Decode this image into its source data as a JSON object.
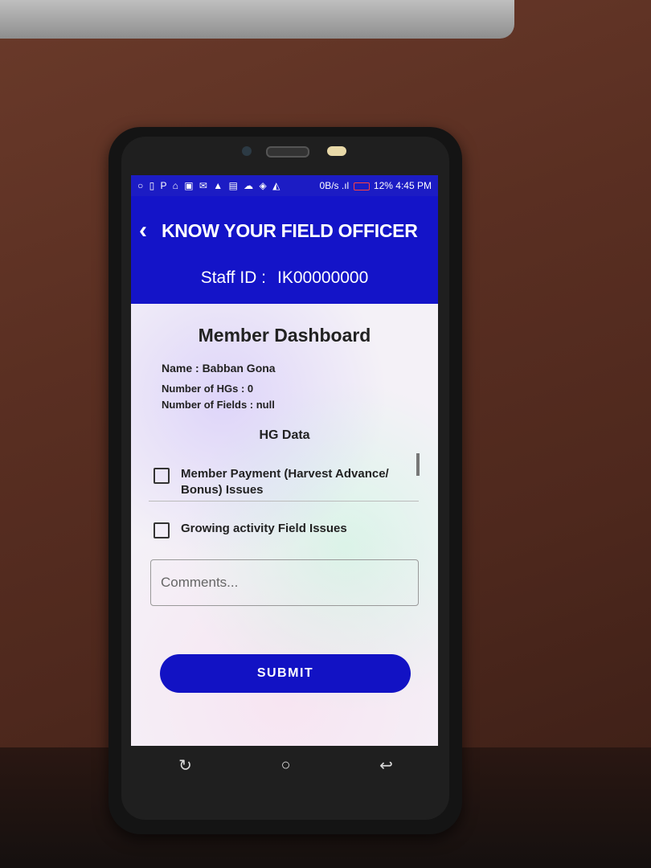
{
  "status_bar": {
    "left_icons": "○ ▯ P ⌂ ▣ ✉ ▲ ▤ ☁ ◈ ◭",
    "net_speed": "0B/s",
    "signal": ".ıl",
    "battery": "12%",
    "time": "4:45 PM"
  },
  "header": {
    "back_icon": "‹",
    "title": "KNOW YOUR FIELD OFFICER",
    "staff_label": "Staff ID :",
    "staff_id": "IK00000000"
  },
  "dashboard": {
    "title": "Member Dashboard",
    "name_line": "Name : Babban Gona",
    "hgs_line": "Number of HGs : 0",
    "fields_line": "Number of Fields : null",
    "hg_title": "HG Data"
  },
  "issues": [
    {
      "label": "Member Payment (Harvest Advance/ Bonus) Issues",
      "checked": false
    },
    {
      "label": "Growing activity Field Issues",
      "checked": false
    }
  ],
  "comments": {
    "placeholder": "Comments...",
    "value": ""
  },
  "submit_label": "SUBMIT",
  "nav": {
    "recent": "↻",
    "home": "○",
    "back": "↩"
  }
}
